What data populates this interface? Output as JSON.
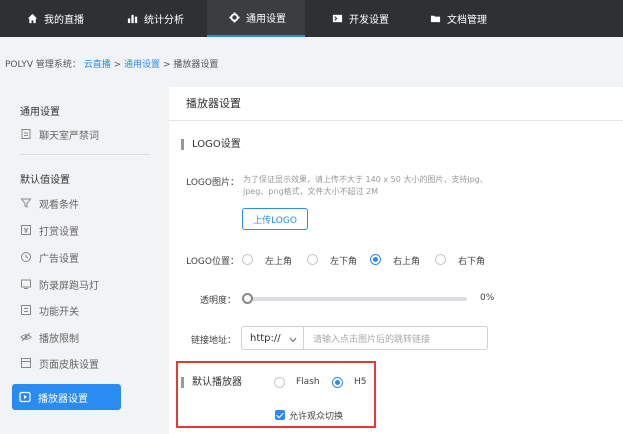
{
  "nav": {
    "items": [
      {
        "label": "我的直播",
        "icon": "home-icon"
      },
      {
        "label": "统计分析",
        "icon": "bar-chart-icon"
      },
      {
        "label": "通用设置",
        "icon": "gear-icon"
      },
      {
        "label": "开发设置",
        "icon": "code-icon"
      },
      {
        "label": "文档管理",
        "icon": "folder-icon"
      }
    ],
    "active": "通用设置"
  },
  "breadcrumb": {
    "prefix": "POLYV 管理系统：",
    "items": [
      "云直播",
      "通用设置",
      "播放器设置"
    ],
    "separator": ">"
  },
  "sidebar": {
    "group1": "通用设置",
    "group1_items": [
      {
        "label": "聊天室严禁词",
        "icon": "doc-icon"
      }
    ],
    "group2": "默认值设置",
    "group2_items": [
      {
        "label": "观看条件",
        "icon": "filter-icon"
      },
      {
        "label": "打赏设置",
        "icon": "reward-icon"
      },
      {
        "label": "广告设置",
        "icon": "ad-icon"
      },
      {
        "label": "防录屏跑马灯",
        "icon": "screen-icon"
      },
      {
        "label": "功能开关",
        "icon": "switch-icon"
      },
      {
        "label": "播放限制",
        "icon": "eye-off-icon"
      },
      {
        "label": "页面皮肤设置",
        "icon": "skin-icon"
      },
      {
        "label": "播放器设置",
        "icon": "player-icon"
      }
    ],
    "active": "播放器设置"
  },
  "main": {
    "title": "播放器设置",
    "section": "LOGO设置",
    "logo_image_label": "LOGO图片：",
    "logo_hint": "为了保证显示效果，请上传不大于 140 x 50 大小的图片，支持jpg、jpeg、png格式，文件大小不超过 2M",
    "upload_button": "上传LOGO",
    "logo_position_label": "LOGO位置：",
    "positions": [
      "左上角",
      "左下角",
      "右上角",
      "右下角"
    ],
    "selected_position": "右上角",
    "opacity_label": "透明度：",
    "opacity_value": "0%",
    "opacity": 0,
    "link_label": "链接地址：",
    "protocol": "http://",
    "link_placeholder": "请输入点击图片后的跳转链接",
    "default_player_label": "默认播放器",
    "players": [
      "Flash",
      "H5"
    ],
    "selected_player": "H5",
    "allow_switch_label": "允许观众切换",
    "allow_switch": true
  },
  "colors": {
    "accent": "#2a8cf0",
    "nav_bg": "#2f3033",
    "highlight": "#e53935"
  }
}
